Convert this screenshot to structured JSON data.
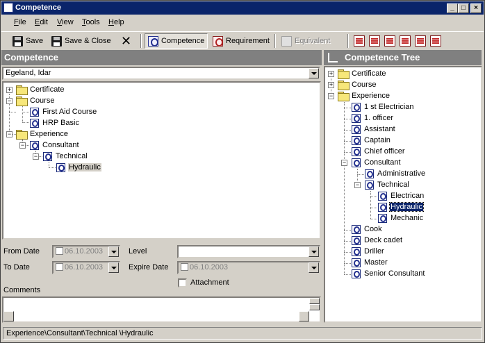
{
  "window": {
    "title": "Competence"
  },
  "menu": [
    {
      "label": "File",
      "u": "F",
      "rest": "ile"
    },
    {
      "label": "Edit",
      "u": "E",
      "rest": "dit"
    },
    {
      "label": "View",
      "u": "V",
      "rest": "iew"
    },
    {
      "label": "Tools",
      "u": "T",
      "rest": "ools"
    },
    {
      "label": "Help",
      "u": "H",
      "rest": "elp"
    }
  ],
  "toolbar": {
    "save_label": "Save",
    "save_close_label": "Save & Close",
    "competence_label": "Competence",
    "requirement_label": "Requirement",
    "equivalent_label": "Equivalent"
  },
  "left": {
    "header": "Competence",
    "person": "Egeland, Idar",
    "tree": {
      "certificate": "Certificate",
      "course": "Course",
      "first_aid": "First Aid Course",
      "hrp": "HRP Basic",
      "experience": "Experience",
      "consultant": "Consultant",
      "technical": "Technical",
      "hydraulic": "Hydraulic"
    },
    "form": {
      "from_date_label": "From Date",
      "from_date_value": "06.10.2003",
      "to_date_label": "To Date",
      "to_date_value": "06.10.2003",
      "level_label": "Level",
      "level_value": "",
      "expire_label": "Expire Date",
      "expire_value": "06.10.2003",
      "attachment_label": "Attachment",
      "comments_label": "Comments"
    }
  },
  "right": {
    "header": "Competence Tree",
    "tree": {
      "certificate": "Certificate",
      "course": "Course",
      "experience": "Experience",
      "items": [
        "1 st Electrician",
        "1. officer",
        "Assistant",
        "Captain",
        "Chief officer",
        "Consultant"
      ],
      "administrative": "Administrative",
      "technical": "Technical",
      "electrican": "Electrican",
      "hydraulic": "Hydraulic",
      "mechanic": "Mechanic",
      "tail_items": [
        "Cook",
        "Deck cadet",
        "Driller",
        "Master",
        "Senior Consultant"
      ]
    }
  },
  "status": {
    "path": "Experience\\Consultant\\Technical \\Hydraulic"
  },
  "colors": {
    "title_bar": "#0a246a",
    "panel_header": "#808080",
    "selection": "#0a246a"
  }
}
